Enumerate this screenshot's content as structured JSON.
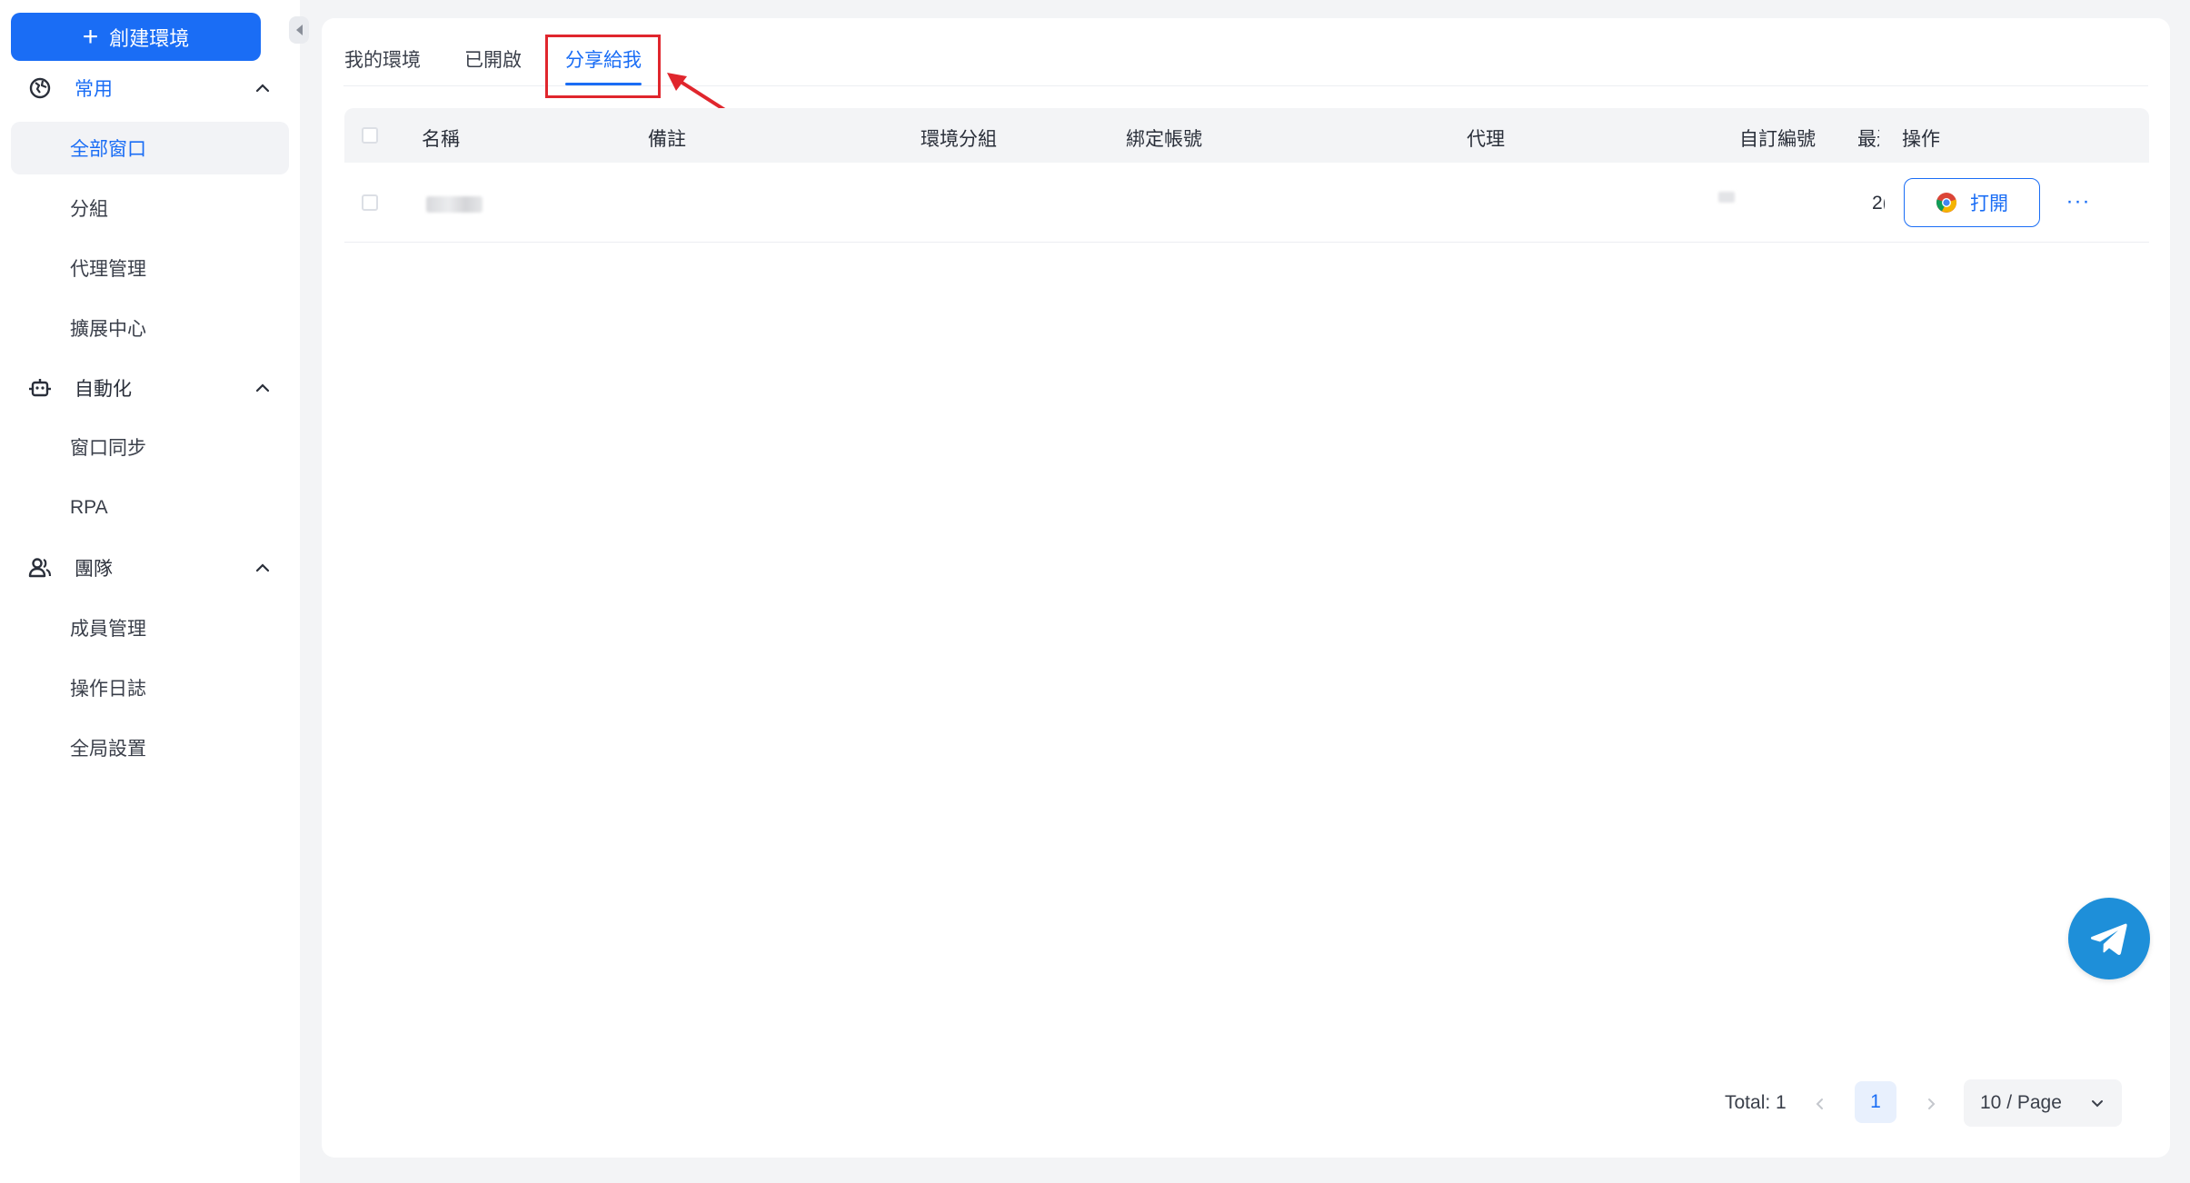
{
  "sidebar": {
    "create_button": "創建環境",
    "groups": [
      {
        "label": "常用",
        "icon": "globe-icon"
      },
      {
        "label": "自動化",
        "icon": "robot-icon"
      },
      {
        "label": "團隊",
        "icon": "team-icon"
      }
    ],
    "items": [
      {
        "label": "全部窗口"
      },
      {
        "label": "分組"
      },
      {
        "label": "代理管理"
      },
      {
        "label": "擴展中心"
      },
      {
        "label": "窗口同步"
      },
      {
        "label": "RPA"
      },
      {
        "label": "成員管理"
      },
      {
        "label": "操作日誌"
      },
      {
        "label": "全局設置"
      }
    ]
  },
  "tabs": [
    {
      "label": "我的環境"
    },
    {
      "label": "已開啟"
    },
    {
      "label": "分享給我"
    }
  ],
  "table": {
    "columns": [
      "名稱",
      "備註",
      "環境分組",
      "綁定帳號",
      "代理",
      "自訂編號",
      "最近",
      "操作"
    ],
    "rows": [
      {
        "last_opened": "2(",
        "open_label": "打開",
        "more": "···"
      }
    ]
  },
  "pagination": {
    "total": "Total: 1",
    "current_page": "1",
    "page_size": "10 / Page"
  },
  "colors": {
    "primary": "#1a6df5",
    "highlight": "#e0262d",
    "telegram": "#1e8fd9"
  }
}
